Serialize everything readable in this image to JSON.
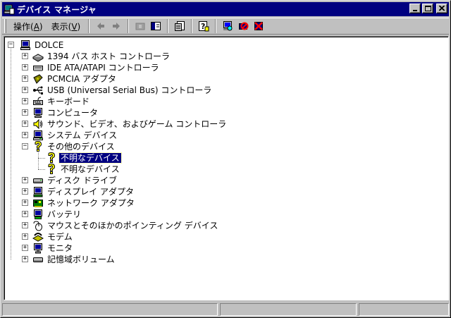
{
  "window": {
    "title": "デバイス マネージャ"
  },
  "menu": [
    {
      "label": "操作",
      "accel": "A"
    },
    {
      "label": "表示",
      "accel": "V"
    }
  ],
  "toolbar_icons": [
    "back-arrow-icon",
    "forward-arrow-icon",
    "folder-up-icon",
    "show-hide-tree-icon",
    "properties-icon",
    "help-icon",
    "scan-hardware-icon",
    "disable-device-icon",
    "uninstall-device-icon"
  ],
  "tree": {
    "root": {
      "label": "DOLCE",
      "icon": "computer-icon"
    },
    "categories": [
      {
        "label": "1394 バス ホスト コントローラ",
        "icon": "bus-controller-icon",
        "expanded": false
      },
      {
        "label": "IDE ATA/ATAPI コントローラ",
        "icon": "ide-controller-icon",
        "expanded": false
      },
      {
        "label": "PCMCIA アダプタ",
        "icon": "pcmcia-adapter-icon",
        "expanded": false
      },
      {
        "label": "USB (Universal Serial Bus) コントローラ",
        "icon": "usb-icon",
        "expanded": false
      },
      {
        "label": "キーボード",
        "icon": "keyboard-icon",
        "expanded": false
      },
      {
        "label": "コンピュータ",
        "icon": "monitor-computer-icon",
        "expanded": false
      },
      {
        "label": "サウンド、ビデオ、およびゲーム コントローラ",
        "icon": "speaker-icon",
        "expanded": false
      },
      {
        "label": "システム デバイス",
        "icon": "system-device-icon",
        "expanded": false
      },
      {
        "label": "その他のデバイス",
        "icon": "unknown-device-icon",
        "expanded": true,
        "children": [
          {
            "label": "不明なデバイス",
            "icon": "unknown-device-icon",
            "selected": true
          },
          {
            "label": "不明なデバイス",
            "icon": "unknown-device-icon",
            "selected": false
          }
        ]
      },
      {
        "label": "ディスク ドライブ",
        "icon": "disk-drive-icon",
        "expanded": false
      },
      {
        "label": "ディスプレイ アダプタ",
        "icon": "display-adapter-icon",
        "expanded": false
      },
      {
        "label": "ネットワーク アダプタ",
        "icon": "network-adapter-icon",
        "expanded": false
      },
      {
        "label": "バッテリ",
        "icon": "battery-icon",
        "expanded": false
      },
      {
        "label": "マウスとそのほかのポインティング デバイス",
        "icon": "mouse-icon",
        "expanded": false
      },
      {
        "label": "モデム",
        "icon": "modem-icon",
        "expanded": false
      },
      {
        "label": "モニタ",
        "icon": "monitor-icon",
        "expanded": false
      },
      {
        "label": "記憶域ボリューム",
        "icon": "storage-volume-icon",
        "expanded": false
      }
    ]
  },
  "colors": {
    "title_bar": "#000080",
    "window_face": "#c0c0c0",
    "selection": "#000080",
    "unknown_device_yellow": "#ffff00"
  }
}
